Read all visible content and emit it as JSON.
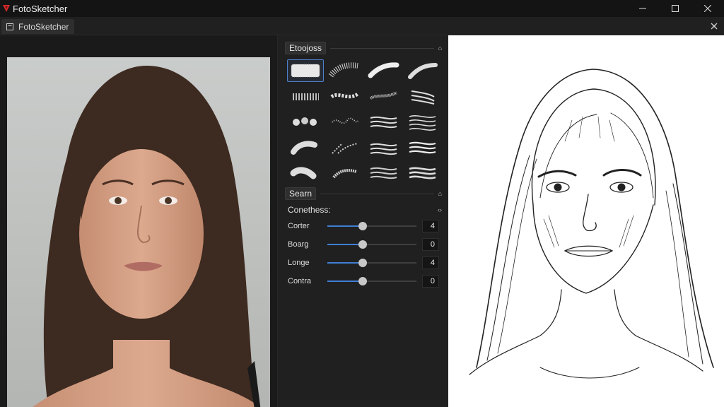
{
  "app": {
    "title": "FotoSketcher"
  },
  "tab": {
    "label": "FotoSketcher"
  },
  "brushes_panel": {
    "title": "Etoojoss"
  },
  "search_panel": {
    "title": "Searn"
  },
  "params": {
    "title": "Conethess:",
    "sliders": [
      {
        "label": "Corter",
        "value": "4",
        "level": 0.4
      },
      {
        "label": "Boarg",
        "value": "0",
        "level": 0.4
      },
      {
        "label": "Longe",
        "value": "4",
        "level": 0.4
      },
      {
        "label": "Contra",
        "value": "0",
        "level": 0.4
      }
    ]
  },
  "colors": {
    "accent": "#3f7fd6",
    "logo": "#d42a2a",
    "sketch_bg": "#ffffff"
  }
}
